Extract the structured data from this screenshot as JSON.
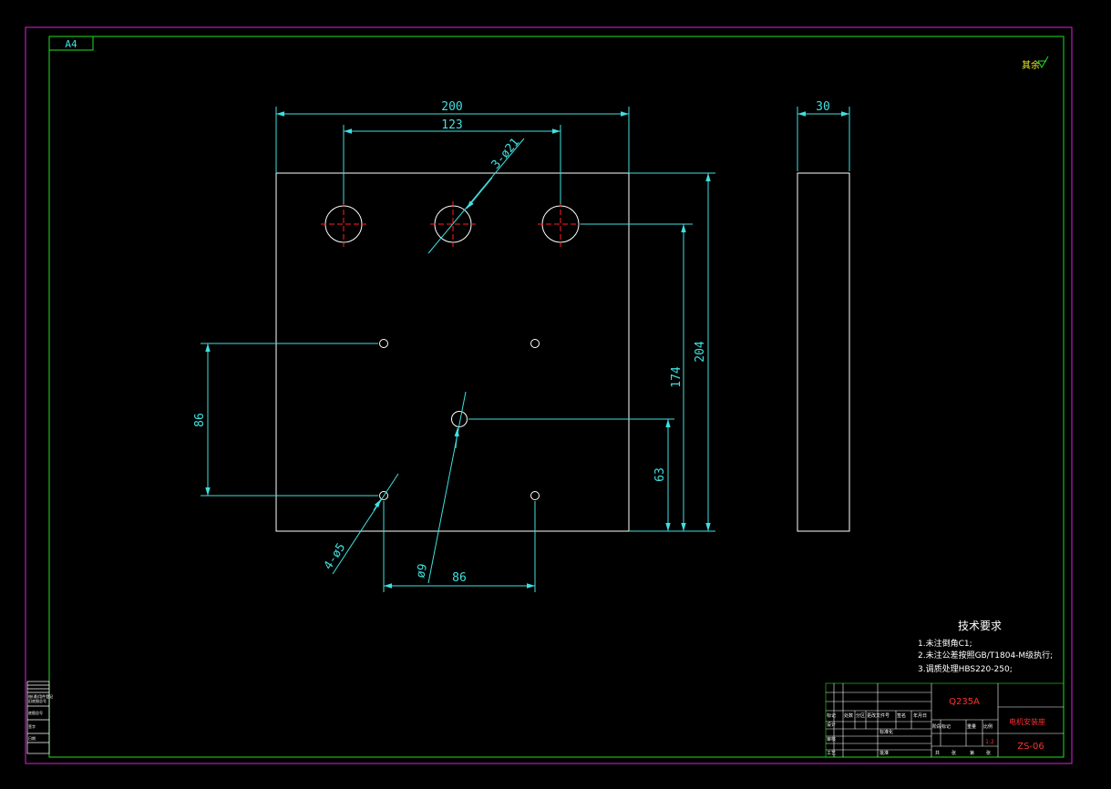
{
  "colors": {
    "background": "#000000",
    "outer_frame": "#e020e0",
    "inner_frame": "#20e020",
    "outline": "#ffffff",
    "dimension": "#3fe0e0",
    "center_line": "#ff2020",
    "title_text_red": "#ff3030",
    "mark_yellow": "#f0f020"
  },
  "sheet": {
    "size_label": "A4",
    "corner_mark": "其余"
  },
  "dimensions": {
    "width_overall": "200",
    "hole_spacing": "123",
    "big_holes_note": "3-ø21",
    "thickness": "30",
    "height_overall": "204",
    "height_holes": "174",
    "height_center_hole": "63",
    "vertical_small_spacing": "86",
    "horizontal_small_spacing": "86",
    "small_holes_note": "4-ø5",
    "center_hole_note": "ø9"
  },
  "tech_requirements": {
    "title": "技术要求",
    "items": [
      "1.未注倒角C1;",
      "2.未注公差按照GB/T1804-M级执行;",
      "3.调质处理HBS220-250;"
    ]
  },
  "title_block": {
    "material": "Q235A",
    "part_name": "电机安装座",
    "drawing_number": "ZS-06",
    "scale_label": "1:2",
    "header_labels": [
      "标记",
      "处数",
      "分区",
      "更改文件号",
      "签名",
      "年月日"
    ],
    "role_labels": [
      "设计",
      "审核",
      "工艺"
    ],
    "sub_labels": [
      "标准化",
      "批准"
    ],
    "stage_labels": [
      "阶段标记",
      "重量",
      "比例"
    ],
    "sheet_labels": [
      "共",
      "张",
      "第",
      "张"
    ]
  },
  "side_table": {
    "labels": [
      "借(通)用件登记",
      "旧底图总号",
      "底图总号",
      "签字",
      "日期"
    ]
  }
}
